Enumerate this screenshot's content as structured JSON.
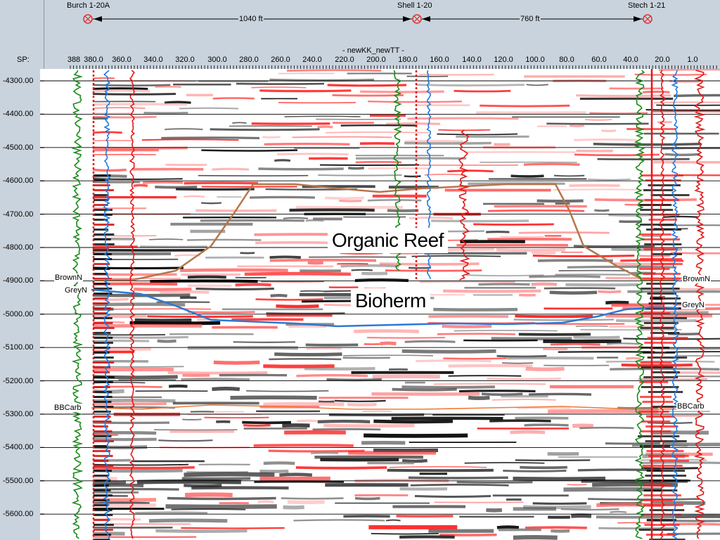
{
  "header": {
    "sp_label": "SP:",
    "line_name": "- newKK_newTT -"
  },
  "wells": [
    {
      "name": "Burch 1-20A"
    },
    {
      "name": "Shell 1-20"
    },
    {
      "name": "Stech 1-21"
    }
  ],
  "distances": [
    {
      "label": "1040 ft"
    },
    {
      "label": "760 ft"
    }
  ],
  "shotpoints": [
    "388",
    "380.0",
    "360.0",
    "340.0",
    "320.0",
    "300.0",
    "280.0",
    "260.0",
    "240.0",
    "220.0",
    "200.0",
    "180.0",
    "160.0",
    "140.0",
    "120.0",
    "100.0",
    "80.0",
    "60.0",
    "40.0",
    "20.0",
    "1.0"
  ],
  "depths": [
    "-4300.00",
    "-4400.00",
    "-4500.00",
    "-4600.00",
    "-4700.00",
    "-4800.00",
    "-4900.00",
    "-5000.00",
    "-5100.00",
    "-5200.00",
    "-5300.00",
    "-5400.00",
    "-5500.00",
    "-5600.00"
  ],
  "horizons": [
    {
      "name": "BrownN",
      "color": "#b5764a"
    },
    {
      "name": "GreyN",
      "color": "#2e78d2"
    },
    {
      "name": "BBCarb",
      "color": "#f07a36"
    }
  ],
  "annotations": {
    "reef": "Organic Reef",
    "bioherm": "Bioherm"
  },
  "colors": {
    "well_symbol": "#e03030",
    "log_green": "#1a8a1a",
    "log_blue": "#1f7be0",
    "log_red": "#e01818",
    "grid": "#000000"
  }
}
